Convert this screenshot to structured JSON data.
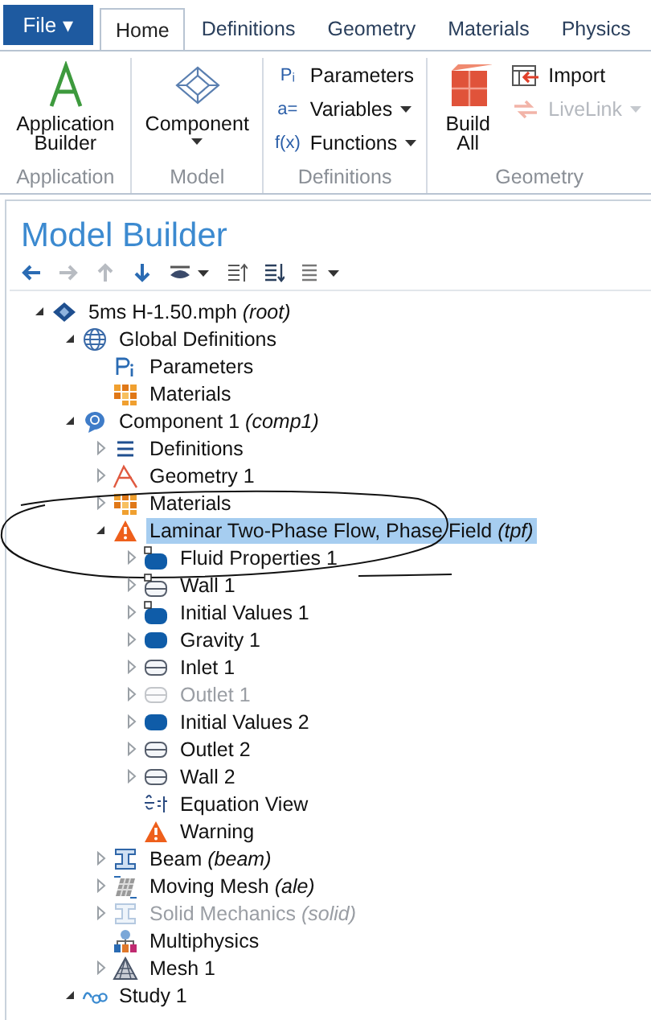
{
  "ribbon": {
    "file_menu": {
      "label": "File",
      "caret": "▾"
    },
    "tabs": [
      {
        "label": "Home",
        "selected": true
      },
      {
        "label": "Definitions",
        "selected": false
      },
      {
        "label": "Geometry",
        "selected": false
      },
      {
        "label": "Materials",
        "selected": false
      },
      {
        "label": "Physics",
        "selected": false
      }
    ],
    "groups": [
      {
        "name": "Application",
        "kind": "big",
        "buttons": [
          {
            "label": "Application Builder",
            "kind": "app-builder",
            "disabled": false
          }
        ]
      },
      {
        "name": "Model",
        "kind": "big",
        "buttons": [
          {
            "label": "Component",
            "kind": "component-cube",
            "dropdown": true,
            "disabled": false
          }
        ]
      },
      {
        "name": "Definitions",
        "kind": "small",
        "buttons": [
          {
            "label": "Parameters",
            "glyph": "Pᵢ",
            "disabled": false
          },
          {
            "label": "Variables",
            "glyph": "a=",
            "dropdown": true,
            "disabled": false
          },
          {
            "label": "Functions",
            "glyph": "f(x)",
            "dropdown": true,
            "disabled": false
          }
        ]
      },
      {
        "name": "Geometry",
        "kind": "mixed",
        "buttons": [
          {
            "label": "Build All",
            "kind": "build",
            "disabled": false
          },
          {
            "label": "Import",
            "kind": "import",
            "disabled": false
          },
          {
            "label": "LiveLink",
            "kind": "livelink",
            "dropdown": true,
            "disabled": true
          }
        ]
      }
    ]
  },
  "model_builder": {
    "title": "Model Builder",
    "tree": [
      {
        "label": "5ms H-1.50.mph",
        "suffix": "(root)",
        "kind": "root",
        "expanded": true,
        "selected": false,
        "disabled": false,
        "children": [
          {
            "label": "Global Definitions",
            "kind": "globe",
            "expanded": true,
            "selected": false,
            "disabled": false,
            "children": [
              {
                "label": "Parameters",
                "kind": "pi",
                "selected": false,
                "disabled": false
              },
              {
                "label": "Materials",
                "kind": "materials",
                "selected": false,
                "disabled": false
              }
            ]
          },
          {
            "label": "Component 1",
            "suffix": "(comp1)",
            "kind": "component",
            "expanded": true,
            "selected": false,
            "disabled": false,
            "children": [
              {
                "label": "Definitions",
                "kind": "list",
                "expanded": false,
                "selected": false,
                "disabled": false
              },
              {
                "label": "Geometry 1",
                "kind": "geometry",
                "expanded": false,
                "selected": false,
                "disabled": false
              },
              {
                "label": "Materials",
                "kind": "materials",
                "expanded": false,
                "selected": false,
                "disabled": false
              },
              {
                "label": "Laminar Two-Phase Flow, Phase Field",
                "suffix": "(tpf)",
                "kind": "warning",
                "expanded": true,
                "selected": true,
                "disabled": false,
                "circled": true,
                "children": [
                  {
                    "label": "Fluid Properties 1",
                    "kind": "domain-default",
                    "expanded": false,
                    "selected": false,
                    "disabled": false
                  },
                  {
                    "label": "Wall 1",
                    "kind": "boundary-default",
                    "expanded": false,
                    "selected": false,
                    "disabled": false
                  },
                  {
                    "label": "Initial Values 1",
                    "kind": "domain-default",
                    "expanded": false,
                    "selected": false,
                    "disabled": false
                  },
                  {
                    "label": "Gravity 1",
                    "kind": "domain",
                    "expanded": false,
                    "selected": false,
                    "disabled": false
                  },
                  {
                    "label": "Inlet 1",
                    "kind": "boundary",
                    "expanded": false,
                    "selected": false,
                    "disabled": false
                  },
                  {
                    "label": "Outlet 1",
                    "kind": "boundary",
                    "expanded": false,
                    "selected": false,
                    "disabled": true
                  },
                  {
                    "label": "Initial Values 2",
                    "kind": "domain",
                    "expanded": false,
                    "selected": false,
                    "disabled": false
                  },
                  {
                    "label": "Outlet 2",
                    "kind": "boundary",
                    "expanded": false,
                    "selected": false,
                    "disabled": false
                  },
                  {
                    "label": "Wall 2",
                    "kind": "boundary",
                    "expanded": false,
                    "selected": false,
                    "disabled": false
                  },
                  {
                    "label": "Equation View",
                    "kind": "equation",
                    "selected": false,
                    "disabled": false
                  },
                  {
                    "label": "Warning",
                    "kind": "warning",
                    "selected": false,
                    "disabled": false
                  }
                ]
              },
              {
                "label": "Beam",
                "suffix": "(beam)",
                "kind": "beam",
                "expanded": false,
                "selected": false,
                "disabled": false
              },
              {
                "label": "Moving Mesh",
                "suffix": "(ale)",
                "kind": "moving-mesh",
                "expanded": false,
                "selected": false,
                "disabled": false
              },
              {
                "label": "Solid Mechanics",
                "suffix": "(solid)",
                "kind": "beam",
                "expanded": false,
                "selected": false,
                "disabled": true
              },
              {
                "label": "Multiphysics",
                "kind": "multiphysics",
                "selected": false,
                "disabled": false
              },
              {
                "label": "Mesh 1",
                "kind": "mesh",
                "expanded": false,
                "selected": false,
                "disabled": false
              }
            ]
          },
          {
            "label": "Study 1",
            "kind": "study",
            "expanded": true,
            "selected": false,
            "disabled": false
          }
        ]
      }
    ]
  }
}
